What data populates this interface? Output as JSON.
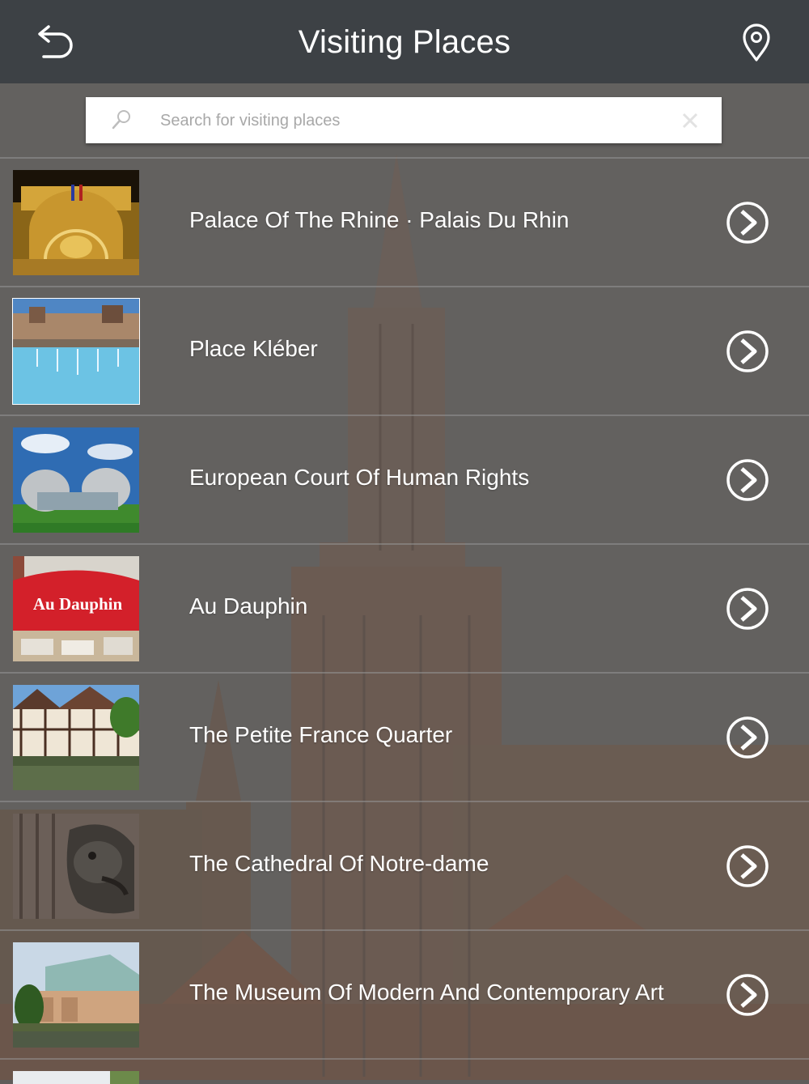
{
  "header": {
    "title": "Visiting Places",
    "back_icon": "back-arrow-icon",
    "location_icon": "map-pin-icon"
  },
  "search": {
    "placeholder": "Search for visiting places",
    "value": "",
    "search_icon": "magnifier-icon",
    "clear_icon": "clear-x-icon"
  },
  "places": [
    {
      "name": "Palace Of The Rhine · Palais Du Rhin",
      "thumb": "palace-night-facade"
    },
    {
      "name": "Place Kléber",
      "thumb": "fountain-square"
    },
    {
      "name": "European Court Of Human Rights",
      "thumb": "court-building"
    },
    {
      "name": "Au Dauphin",
      "thumb": "red-shop-sign"
    },
    {
      "name": "The Petite France Quarter",
      "thumb": "half-timbered-houses"
    },
    {
      "name": "The Cathedral Of Notre-dame",
      "thumb": "gargoyle-sculpture"
    },
    {
      "name": "The Museum Of Modern And Contemporary Art",
      "thumb": "museum-building"
    }
  ],
  "thumb_texts": {
    "au_dauphin_sign": "Au Dauphin"
  },
  "colors": {
    "topbar": "#3d4145",
    "overlay": "#5f5d5b",
    "text": "#ffffff"
  }
}
